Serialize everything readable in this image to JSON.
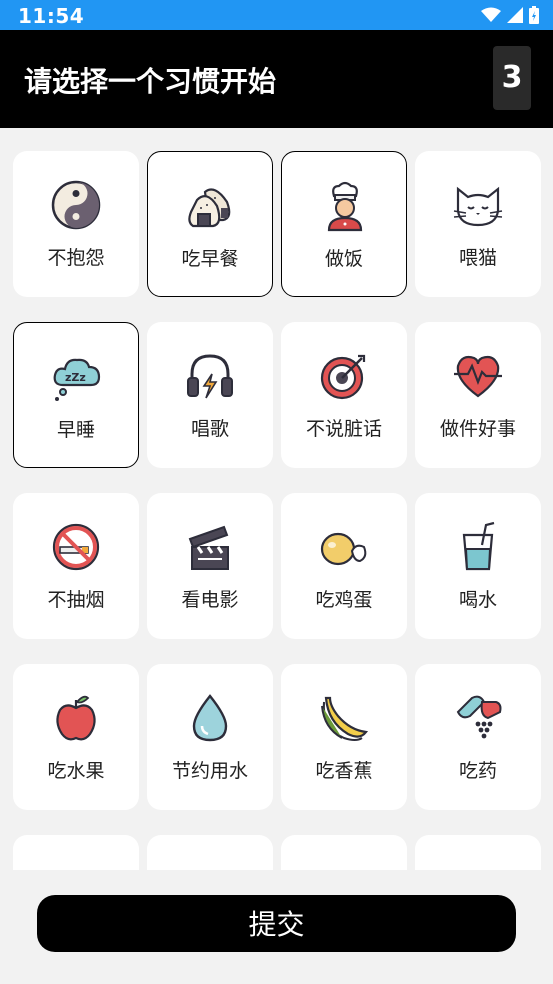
{
  "status": {
    "time": "11:54"
  },
  "header": {
    "title": "请选择一个习惯开始",
    "selected_count": "3"
  },
  "habits": [
    {
      "label": "不抱怨",
      "icon": "yin-yang-icon",
      "selected": false
    },
    {
      "label": "吃早餐",
      "icon": "rice-ball-icon",
      "selected": true
    },
    {
      "label": "做饭",
      "icon": "chef-icon",
      "selected": true
    },
    {
      "label": "喂猫",
      "icon": "cat-icon",
      "selected": false
    },
    {
      "label": "早睡",
      "icon": "sleep-cloud-icon",
      "selected": true
    },
    {
      "label": "唱歌",
      "icon": "headphones-icon",
      "selected": false
    },
    {
      "label": "不说脏话",
      "icon": "target-icon",
      "selected": false
    },
    {
      "label": "做件好事",
      "icon": "heart-pulse-icon",
      "selected": false
    },
    {
      "label": "不抽烟",
      "icon": "no-smoking-icon",
      "selected": false
    },
    {
      "label": "看电影",
      "icon": "clapperboard-icon",
      "selected": false
    },
    {
      "label": "吃鸡蛋",
      "icon": "egg-icon",
      "selected": false
    },
    {
      "label": "喝水",
      "icon": "water-glass-icon",
      "selected": false
    },
    {
      "label": "吃水果",
      "icon": "apple-icon",
      "selected": false
    },
    {
      "label": "节约用水",
      "icon": "water-drop-icon",
      "selected": false
    },
    {
      "label": "吃香蕉",
      "icon": "banana-icon",
      "selected": false
    },
    {
      "label": "吃药",
      "icon": "pills-icon",
      "selected": false
    }
  ],
  "footer": {
    "submit_label": "提交"
  },
  "colors": {
    "statusbar": "#2196f3",
    "appbar": "#000000"
  }
}
